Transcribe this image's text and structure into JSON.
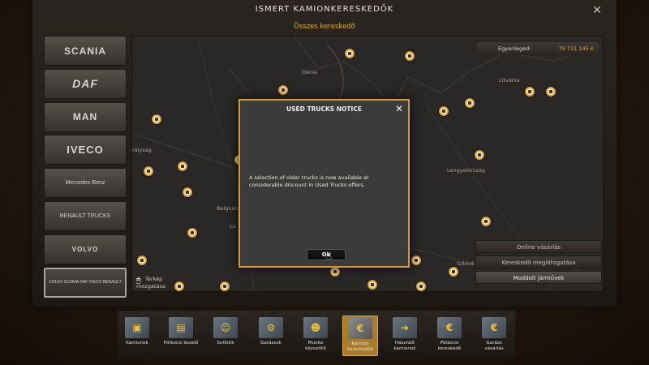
{
  "window": {
    "title": "ISMERT KAMIONKERESKEDŐK",
    "subtitle": "Összes kereskedő"
  },
  "brands": [
    {
      "name": "SCANIA"
    },
    {
      "name": "DAF"
    },
    {
      "name": "MAN"
    },
    {
      "name": "IVECO"
    },
    {
      "name": "Mercedes-Benz"
    },
    {
      "name": "RENAULT TRUCKS"
    },
    {
      "name": "VOLVO"
    },
    {
      "name": "VOLVO SCANIA DAF IVECO RENAULT"
    }
  ],
  "balance": {
    "label": "Egyenleged:",
    "value": "79 731 145 €"
  },
  "map": {
    "labels": {
      "denmark": "Dánia",
      "lithuania": "Litvánia",
      "uk": "rálysag",
      "belgium": "Belgium",
      "lu": "Lu",
      "poland": "Lengyelország",
      "slovakia": "Szlová"
    },
    "move_label_line1": "Térkép",
    "move_label_line2": "mozgatása"
  },
  "side_buttons": {
    "online": "Online vásárlás",
    "dealer_visit": "Kereskedő meglátogatása",
    "modded": "Moddolt járművek"
  },
  "modal": {
    "title": "USED TRUCKS NOTICE",
    "text": "A selection of older trucks is now available at considerable discount in Used Trucks offers.",
    "ok": "Ok"
  },
  "toolbar": [
    {
      "label": "Kamionok",
      "icon": "truck-icon"
    },
    {
      "label": "Pótkocsi kezelő",
      "icon": "trailer-icon"
    },
    {
      "label": "Sofőrök",
      "icon": "drivers-icon"
    },
    {
      "label": "Garázsok",
      "icon": "garage-icon"
    },
    {
      "label": "Munka közvetítő",
      "icon": "recruitment-icon"
    },
    {
      "label": "Kamion kereskedők",
      "icon": "dealer-icon"
    },
    {
      "label": "Használt kamionok",
      "icon": "used-truck-icon"
    },
    {
      "label": "Pótkocsi kereskedő",
      "icon": "trailer-dealer-icon"
    },
    {
      "label": "Garázs vásárlás",
      "icon": "buy-garage-icon"
    }
  ]
}
